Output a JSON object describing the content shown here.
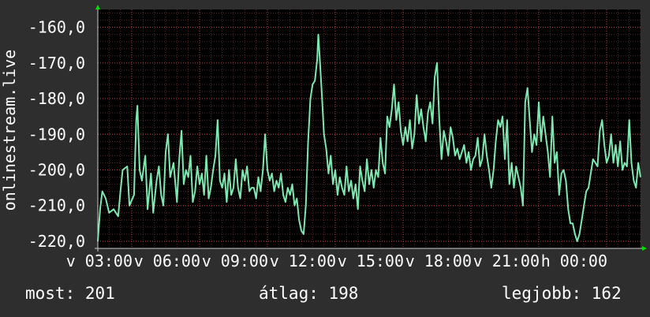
{
  "chart_data": {
    "type": "line",
    "ylabel": "onlinestream.live",
    "ylim": [
      -222,
      -155
    ],
    "yticks": [
      {
        "value": -160,
        "label": "-160,0"
      },
      {
        "value": -170,
        "label": "-170,0"
      },
      {
        "value": -180,
        "label": "-180,0"
      },
      {
        "value": -190,
        "label": "-190,0"
      },
      {
        "value": -200,
        "label": "-200,0"
      },
      {
        "value": -210,
        "label": "-210,0"
      },
      {
        "value": -220,
        "label": "-220,0"
      }
    ],
    "xlim": [
      0,
      24
    ],
    "xticks": [
      {
        "value": 0,
        "label": "v 03:00"
      },
      {
        "value": 3,
        "label": "v 06:00"
      },
      {
        "value": 6,
        "label": "v 09:00"
      },
      {
        "value": 9,
        "label": "v 12:00"
      },
      {
        "value": 12,
        "label": "v 15:00"
      },
      {
        "value": 15,
        "label": "v 18:00"
      },
      {
        "value": 18,
        "label": "v 21:00"
      },
      {
        "value": 21,
        "label": "h 00:00"
      }
    ],
    "grid": true,
    "colors": {
      "line": "#7ee8b0",
      "grid": "#d94a4a",
      "axis": "#00e000",
      "background": "#2e2e2e",
      "plot_bg": "#000000"
    },
    "series": [
      {
        "values": [
          [
            0.0,
            -220
          ],
          [
            0.1,
            -211
          ],
          [
            0.2,
            -206
          ],
          [
            0.35,
            -208
          ],
          [
            0.5,
            -212
          ],
          [
            0.7,
            -211
          ],
          [
            0.9,
            -213
          ],
          [
            1.0,
            -206
          ],
          [
            1.1,
            -200
          ],
          [
            1.3,
            -199
          ],
          [
            1.4,
            -210
          ],
          [
            1.6,
            -207
          ],
          [
            1.7,
            -186
          ],
          [
            1.75,
            -182
          ],
          [
            1.85,
            -200
          ],
          [
            1.95,
            -203
          ],
          [
            2.1,
            -196
          ],
          [
            2.2,
            -211
          ],
          [
            2.35,
            -201
          ],
          [
            2.45,
            -212
          ],
          [
            2.6,
            -203
          ],
          [
            2.7,
            -199
          ],
          [
            2.8,
            -207
          ],
          [
            2.9,
            -210
          ],
          [
            3.0,
            -195
          ],
          [
            3.1,
            -190
          ],
          [
            3.2,
            -202
          ],
          [
            3.35,
            -198
          ],
          [
            3.5,
            -209
          ],
          [
            3.6,
            -197
          ],
          [
            3.7,
            -189
          ],
          [
            3.8,
            -204
          ],
          [
            3.9,
            -200
          ],
          [
            4.0,
            -202
          ],
          [
            4.1,
            -196
          ],
          [
            4.2,
            -209
          ],
          [
            4.3,
            -206
          ],
          [
            4.4,
            -199
          ],
          [
            4.5,
            -204
          ],
          [
            4.6,
            -201
          ],
          [
            4.7,
            -207
          ],
          [
            4.8,
            -196
          ],
          [
            4.9,
            -208
          ],
          [
            5.0,
            -205
          ],
          [
            5.1,
            -200
          ],
          [
            5.2,
            -196
          ],
          [
            5.3,
            -186
          ],
          [
            5.4,
            -203
          ],
          [
            5.5,
            -205
          ],
          [
            5.6,
            -201
          ],
          [
            5.7,
            -209
          ],
          [
            5.8,
            -200
          ],
          [
            5.9,
            -207
          ],
          [
            6.0,
            -205
          ],
          [
            6.1,
            -197
          ],
          [
            6.2,
            -205
          ],
          [
            6.3,
            -208
          ],
          [
            6.4,
            -200
          ],
          [
            6.5,
            -203
          ],
          [
            6.6,
            -199
          ],
          [
            6.7,
            -206
          ],
          [
            6.8,
            -205
          ],
          [
            6.9,
            -205
          ],
          [
            7.0,
            -208
          ],
          [
            7.1,
            -202
          ],
          [
            7.2,
            -206
          ],
          [
            7.3,
            -200
          ],
          [
            7.4,
            -190
          ],
          [
            7.5,
            -200
          ],
          [
            7.6,
            -203
          ],
          [
            7.7,
            -201
          ],
          [
            7.8,
            -206
          ],
          [
            7.9,
            -203
          ],
          [
            8.0,
            -205
          ],
          [
            8.1,
            -201
          ],
          [
            8.2,
            -207
          ],
          [
            8.3,
            -209
          ],
          [
            8.4,
            -205
          ],
          [
            8.5,
            -207
          ],
          [
            8.6,
            -204
          ],
          [
            8.7,
            -210
          ],
          [
            8.8,
            -208
          ],
          [
            8.9,
            -214
          ],
          [
            9.0,
            -217
          ],
          [
            9.1,
            -218
          ],
          [
            9.2,
            -210
          ],
          [
            9.3,
            -192
          ],
          [
            9.4,
            -180
          ],
          [
            9.5,
            -176
          ],
          [
            9.6,
            -175
          ],
          [
            9.7,
            -169
          ],
          [
            9.75,
            -162
          ],
          [
            9.8,
            -167
          ],
          [
            9.9,
            -178
          ],
          [
            10.0,
            -190
          ],
          [
            10.1,
            -194
          ],
          [
            10.2,
            -201
          ],
          [
            10.3,
            -196
          ],
          [
            10.4,
            -204
          ],
          [
            10.5,
            -200
          ],
          [
            10.6,
            -207
          ],
          [
            10.7,
            -202
          ],
          [
            10.8,
            -205
          ],
          [
            10.9,
            -207
          ],
          [
            11.0,
            -199
          ],
          [
            11.1,
            -206
          ],
          [
            11.2,
            -203
          ],
          [
            11.3,
            -208
          ],
          [
            11.4,
            -204
          ],
          [
            11.5,
            -211
          ],
          [
            11.6,
            -199
          ],
          [
            11.7,
            -203
          ],
          [
            11.8,
            -206
          ],
          [
            11.9,
            -197
          ],
          [
            12.0,
            -204
          ],
          [
            12.1,
            -200
          ],
          [
            12.2,
            -205
          ],
          [
            12.3,
            -200
          ],
          [
            12.4,
            -202
          ],
          [
            12.5,
            -191
          ],
          [
            12.6,
            -198
          ],
          [
            12.7,
            -201
          ],
          [
            12.8,
            -185
          ],
          [
            12.9,
            -188
          ],
          [
            13.0,
            -183
          ],
          [
            13.1,
            -176
          ],
          [
            13.2,
            -186
          ],
          [
            13.3,
            -181
          ],
          [
            13.4,
            -189
          ],
          [
            13.5,
            -193
          ],
          [
            13.6,
            -188
          ],
          [
            13.7,
            -192
          ],
          [
            13.8,
            -186
          ],
          [
            13.9,
            -194
          ],
          [
            14.0,
            -190
          ],
          [
            14.1,
            -179
          ],
          [
            14.2,
            -187
          ],
          [
            14.3,
            -183
          ],
          [
            14.4,
            -188
          ],
          [
            14.5,
            -192
          ],
          [
            14.6,
            -184
          ],
          [
            14.7,
            -181
          ],
          [
            14.8,
            -187
          ],
          [
            14.9,
            -174
          ],
          [
            15.0,
            -170
          ],
          [
            15.1,
            -186
          ],
          [
            15.2,
            -197
          ],
          [
            15.3,
            -189
          ],
          [
            15.4,
            -192
          ],
          [
            15.5,
            -196
          ],
          [
            15.6,
            -188
          ],
          [
            15.7,
            -191
          ],
          [
            15.8,
            -196
          ],
          [
            15.9,
            -194
          ],
          [
            16.0,
            -197
          ],
          [
            16.1,
            -195
          ],
          [
            16.2,
            -193
          ],
          [
            16.3,
            -198
          ],
          [
            16.4,
            -195
          ],
          [
            16.5,
            -200
          ],
          [
            16.6,
            -197
          ],
          [
            16.7,
            -196
          ],
          [
            16.8,
            -191
          ],
          [
            16.9,
            -199
          ],
          [
            17.0,
            -197
          ],
          [
            17.1,
            -190
          ],
          [
            17.2,
            -196
          ],
          [
            17.3,
            -200
          ],
          [
            17.4,
            -205
          ],
          [
            17.5,
            -200
          ],
          [
            17.6,
            -192
          ],
          [
            17.7,
            -186
          ],
          [
            17.8,
            -188
          ],
          [
            17.9,
            -185
          ],
          [
            18.0,
            -197
          ],
          [
            18.1,
            -186
          ],
          [
            18.2,
            -204
          ],
          [
            18.3,
            -198
          ],
          [
            18.4,
            -205
          ],
          [
            18.5,
            -199
          ],
          [
            18.6,
            -202
          ],
          [
            18.7,
            -205
          ],
          [
            18.8,
            -210
          ],
          [
            18.9,
            -181
          ],
          [
            19.0,
            -177
          ],
          [
            19.1,
            -186
          ],
          [
            19.2,
            -195
          ],
          [
            19.3,
            -190
          ],
          [
            19.4,
            -193
          ],
          [
            19.5,
            -181
          ],
          [
            19.6,
            -192
          ],
          [
            19.7,
            -185
          ],
          [
            19.8,
            -190
          ],
          [
            19.9,
            -195
          ],
          [
            20.0,
            -202
          ],
          [
            20.1,
            -185
          ],
          [
            20.2,
            -198
          ],
          [
            20.3,
            -195
          ],
          [
            20.4,
            -207
          ],
          [
            20.5,
            -201
          ],
          [
            20.6,
            -200
          ],
          [
            20.7,
            -203
          ],
          [
            20.8,
            -211
          ],
          [
            20.9,
            -215
          ],
          [
            21.0,
            -215
          ],
          [
            21.1,
            -218
          ],
          [
            21.2,
            -220
          ],
          [
            21.3,
            -218
          ],
          [
            21.4,
            -214
          ],
          [
            21.5,
            -210
          ],
          [
            21.6,
            -206
          ],
          [
            21.7,
            -205
          ],
          [
            21.8,
            -201
          ],
          [
            21.9,
            -197
          ],
          [
            22.0,
            -198
          ],
          [
            22.1,
            -199
          ],
          [
            22.2,
            -189
          ],
          [
            22.3,
            -186
          ],
          [
            22.4,
            -193
          ],
          [
            22.5,
            -198
          ],
          [
            22.6,
            -196
          ],
          [
            22.7,
            -190
          ],
          [
            22.8,
            -198
          ],
          [
            22.9,
            -193
          ],
          [
            23.0,
            -199
          ],
          [
            23.1,
            -192
          ],
          [
            23.2,
            -200
          ],
          [
            23.3,
            -198
          ],
          [
            23.4,
            -199
          ],
          [
            23.5,
            -186
          ],
          [
            23.6,
            -198
          ],
          [
            23.7,
            -203
          ],
          [
            23.8,
            -205
          ],
          [
            23.9,
            -198
          ],
          [
            24.0,
            -202
          ]
        ]
      }
    ]
  },
  "stats": {
    "now": "most: 201",
    "avg": "átlag: 198",
    "best": "legjobb: 162"
  }
}
